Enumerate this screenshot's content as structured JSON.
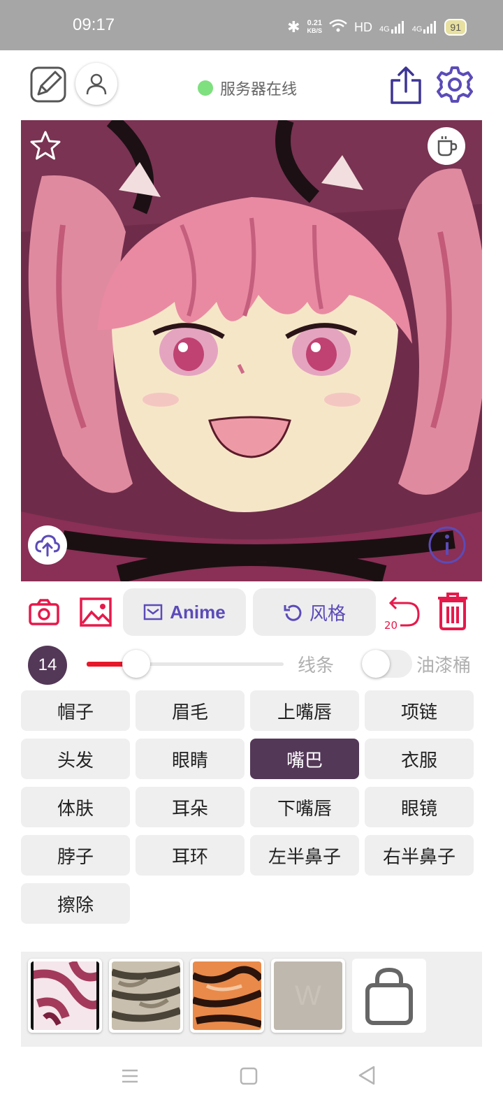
{
  "status_bar": {
    "time": "09:17",
    "net_speed_value": "0.21",
    "net_speed_unit": "KB/S",
    "hd_label": "HD",
    "sig1": "4G",
    "sig2": "4G",
    "battery": "91"
  },
  "header": {
    "server_status": "服务器在线",
    "status_color": "#7ee07e"
  },
  "toolbar": {
    "mode_label": "Anime",
    "style_label": "风格",
    "undo_count": "20",
    "accent": "#5b4bb8",
    "danger": "#e6194b"
  },
  "brush": {
    "size": "14",
    "level": 0.25,
    "lines_label": "线条",
    "bucket_label": "油漆桶",
    "bucket_enabled": false
  },
  "parts": {
    "hat": "帽子",
    "eyebrow": "眉毛",
    "upper_lip": "上嘴唇",
    "necklace": "项链",
    "hair": "头发",
    "eyes": "眼睛",
    "mouth": "嘴巴",
    "clothes": "衣服",
    "skin": "体肤",
    "ears": "耳朵",
    "lower_lip": "下嘴唇",
    "glasses": "眼镜",
    "neck": "脖子",
    "earring": "耳环",
    "left_nose": "左半鼻子",
    "right_nose": "右半鼻子",
    "erase": "擦除",
    "selected": "嘴巴"
  }
}
